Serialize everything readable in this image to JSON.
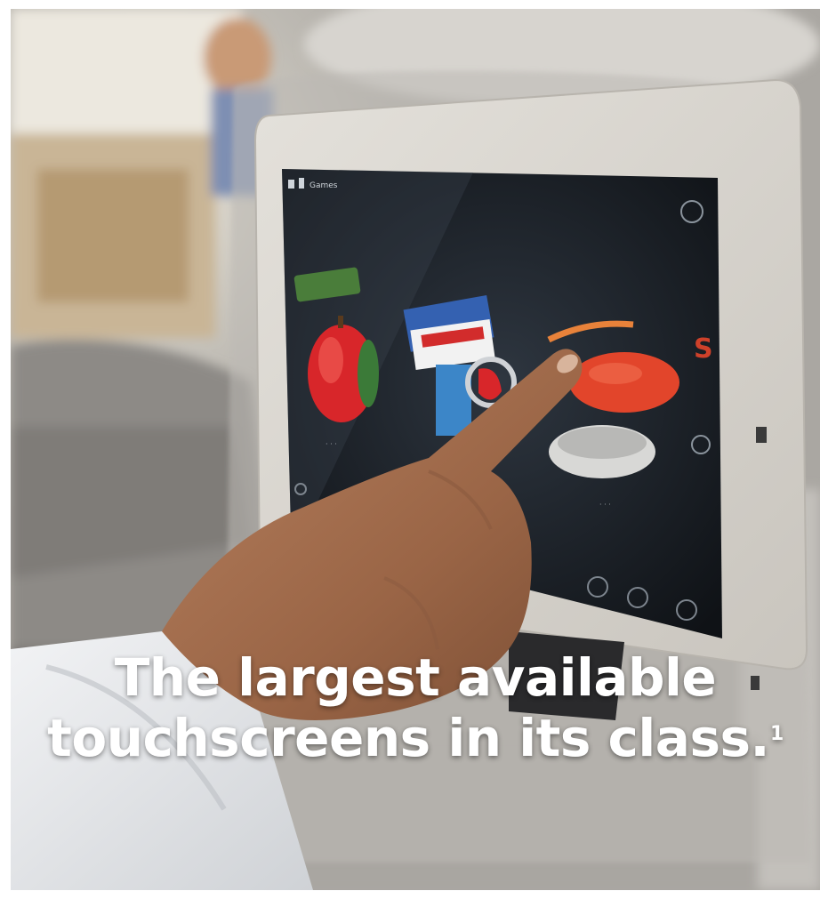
{
  "headline": {
    "line1": "The largest available",
    "line2": "touchscreens in its class.",
    "footnote_marker": "1",
    "color": "#ffffff"
  },
  "screen": {
    "header_text": "Games",
    "games": [
      {
        "label": "Apples to Apples",
        "icon": "apple-game-icon"
      },
      {
        "label": "Mixer Game",
        "icon": "card-game-icon"
      },
      {
        "label": "Checkers",
        "icon": "checkers-game-icon"
      }
    ]
  },
  "colors": {
    "bezel": "#d9d6d0",
    "screen": "#161a20",
    "apple_red": "#d8262a",
    "checkers_orange": "#e2452b"
  }
}
